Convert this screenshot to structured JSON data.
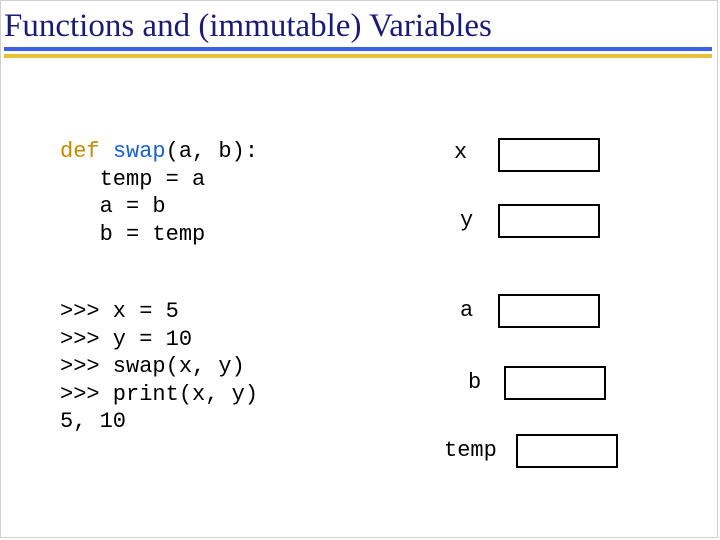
{
  "title": "Functions and (immutable) Variables",
  "code": {
    "def_kw": "def",
    "fn_name": "swap",
    "sig_rest": "(a, b):",
    "body1": "   temp = a",
    "body2": "   a = b",
    "body3": "   b = temp",
    "repl1": ">>> x = 5",
    "repl2": ">>> y = 10",
    "repl3": ">>> swap(x, y)",
    "repl4": ">>> print(x, y)",
    "output": "5, 10"
  },
  "vars": {
    "x": "x",
    "y": "y",
    "a": "a",
    "b": "b",
    "temp": "temp"
  }
}
